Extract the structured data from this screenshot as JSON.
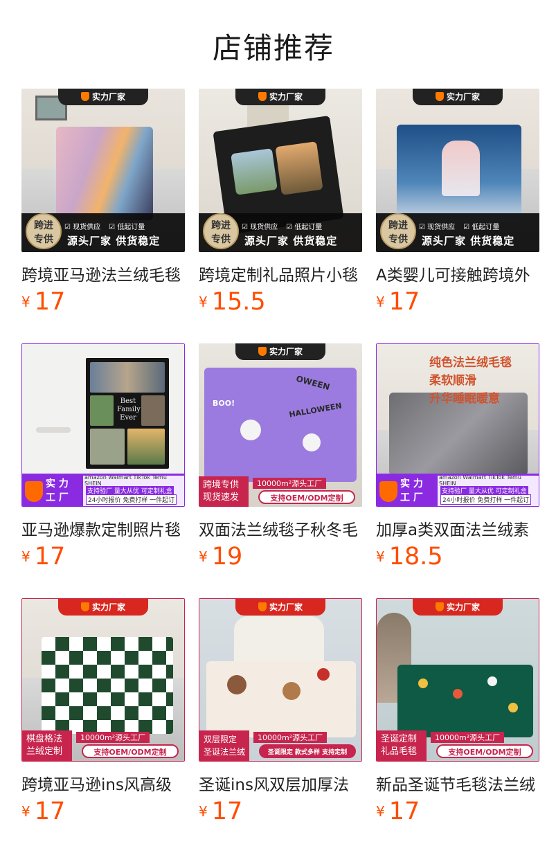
{
  "page": {
    "title": "店铺推荐"
  },
  "products": [
    {
      "name": "跨境亚马逊法兰绒毛毯",
      "currency": "¥",
      "price": "17",
      "image": {
        "ribbon": "实力厂家",
        "badge_lines": [
          "跨进",
          "专供"
        ],
        "checks": [
          "现货供应",
          "低起订量"
        ],
        "slogan": "源头厂家 供货稳定"
      }
    },
    {
      "name": "跨境定制礼品照片小毯",
      "currency": "¥",
      "price": "15.5",
      "image": {
        "ribbon": "实力厂家",
        "badge_lines": [
          "跨进",
          "专供"
        ],
        "checks": [
          "现货供应",
          "低起订量"
        ],
        "slogan": "源头厂家 供货稳定"
      }
    },
    {
      "name": "A类婴儿可接触跨境外",
      "currency": "¥",
      "price": "17",
      "image": {
        "ribbon": "实力厂家",
        "badge_lines": [
          "跨进",
          "专供"
        ],
        "checks": [
          "现货供应",
          "低起订量"
        ],
        "slogan": "源头厂家 供货稳定"
      }
    },
    {
      "name": "亚马逊爆款定制照片毯",
      "currency": "¥",
      "price": "17",
      "image": {
        "photo_text": [
          "Best",
          "Family",
          "Ever"
        ],
        "tag_lines": [
          "实 力",
          "工 厂"
        ],
        "brands": "amazon Walmart TikTok Temu SHEIN",
        "line1": "支持验厂 量大从优 可定制礼盒",
        "line2": "24小时报价 免费打样 一件起订"
      }
    },
    {
      "name": "双面法兰绒毯子秋冬毛",
      "currency": "¥",
      "price": "19",
      "image": {
        "ribbon": "实力厂家",
        "print_words": [
          "HALLOWEEN",
          "BOO!",
          "OWEEN"
        ],
        "left_lines": [
          "跨境专供",
          "现货速发"
        ],
        "top_line": "10000m²源头工厂",
        "button": "支持OEM/ODM定制"
      }
    },
    {
      "name": "加厚a类双面法兰绒素",
      "currency": "¥",
      "price": "18.5",
      "image": {
        "headline": [
          "纯色法兰绒毛毯",
          "柔软顺滑",
          "升华睡眠暖意"
        ],
        "tag_lines": [
          "实 力",
          "工 厂"
        ],
        "brands": "amazon Walmart TikTok Temu SHEIN",
        "line1": "支持验厂 量大从优 可定制礼盒",
        "line2": "24小时报价 免费打样 一件起订"
      }
    },
    {
      "name": "跨境亚马逊ins风高级",
      "currency": "¥",
      "price": "17",
      "image": {
        "ribbon": "实力厂家",
        "left_lines": [
          "棋盘格法",
          "兰绒定制"
        ],
        "top_line": "10000m²源头工厂",
        "button": "支持OEM/ODM定制"
      }
    },
    {
      "name": "圣诞ins风双层加厚法",
      "currency": "¥",
      "price": "17",
      "image": {
        "ribbon": "实力厂家",
        "left_lines": [
          "双层限定",
          "圣诞法兰绒"
        ],
        "top_line": "10000m²源头工厂",
        "button": "圣诞限定 款式多样 支持定制"
      }
    },
    {
      "name": "新品圣诞节毛毯法兰绒",
      "currency": "¥",
      "price": "17",
      "image": {
        "ribbon": "实力厂家",
        "left_lines": [
          "圣诞定制",
          "礼品毛毯"
        ],
        "top_line": "10000m²源头工厂",
        "button": "支持OEM/ODM定制"
      }
    }
  ]
}
